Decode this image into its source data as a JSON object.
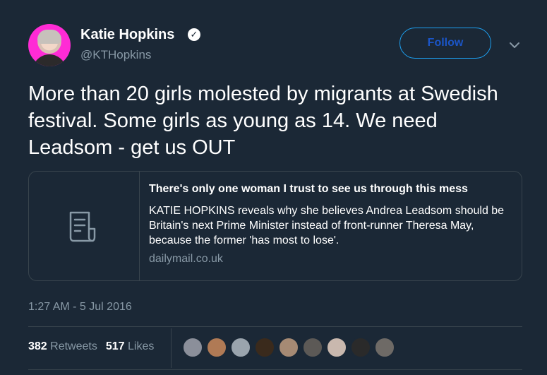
{
  "author": {
    "display_name": "Katie Hopkins",
    "handle": "@KTHopkins",
    "verified_icon": "verified-badge-icon"
  },
  "header": {
    "follow_label": "Follow",
    "menu_icon": "chevron-down-icon"
  },
  "tweet": {
    "text": "More than 20 girls molested by migrants at Swedish festival. Some girls as young as 14. We need Leadsom - get us OUT"
  },
  "card": {
    "thumbnail_icon": "document-icon",
    "title": "There's only one woman I trust to see us through this mess",
    "description": "KATIE HOPKINS reveals why she believes Andrea Leadsom should be Britain's next Prime Minister instead of front-runner Theresa May, because the former 'has most to lose'.",
    "domain": "dailymail.co.uk"
  },
  "timestamp": "1:27 AM - 5 Jul 2016",
  "stats": {
    "retweets_count": "382",
    "retweets_label": "Retweets",
    "likes_count": "517",
    "likes_label": "Likes"
  },
  "liker_avatars": [
    {
      "color": "#8b8f9a"
    },
    {
      "color": "#b07a55"
    },
    {
      "color": "#9aa4ad"
    },
    {
      "color": "#3a2a1c"
    },
    {
      "color": "#a68a74"
    },
    {
      "color": "#5c5956"
    },
    {
      "color": "#c9b8ae"
    },
    {
      "color": "#2a2a2a"
    },
    {
      "color": "#6e6a66"
    }
  ],
  "colors": {
    "background": "#1b2836",
    "accent": "#1da1f2",
    "secondary_text": "#8899a6",
    "border": "#38444d"
  }
}
